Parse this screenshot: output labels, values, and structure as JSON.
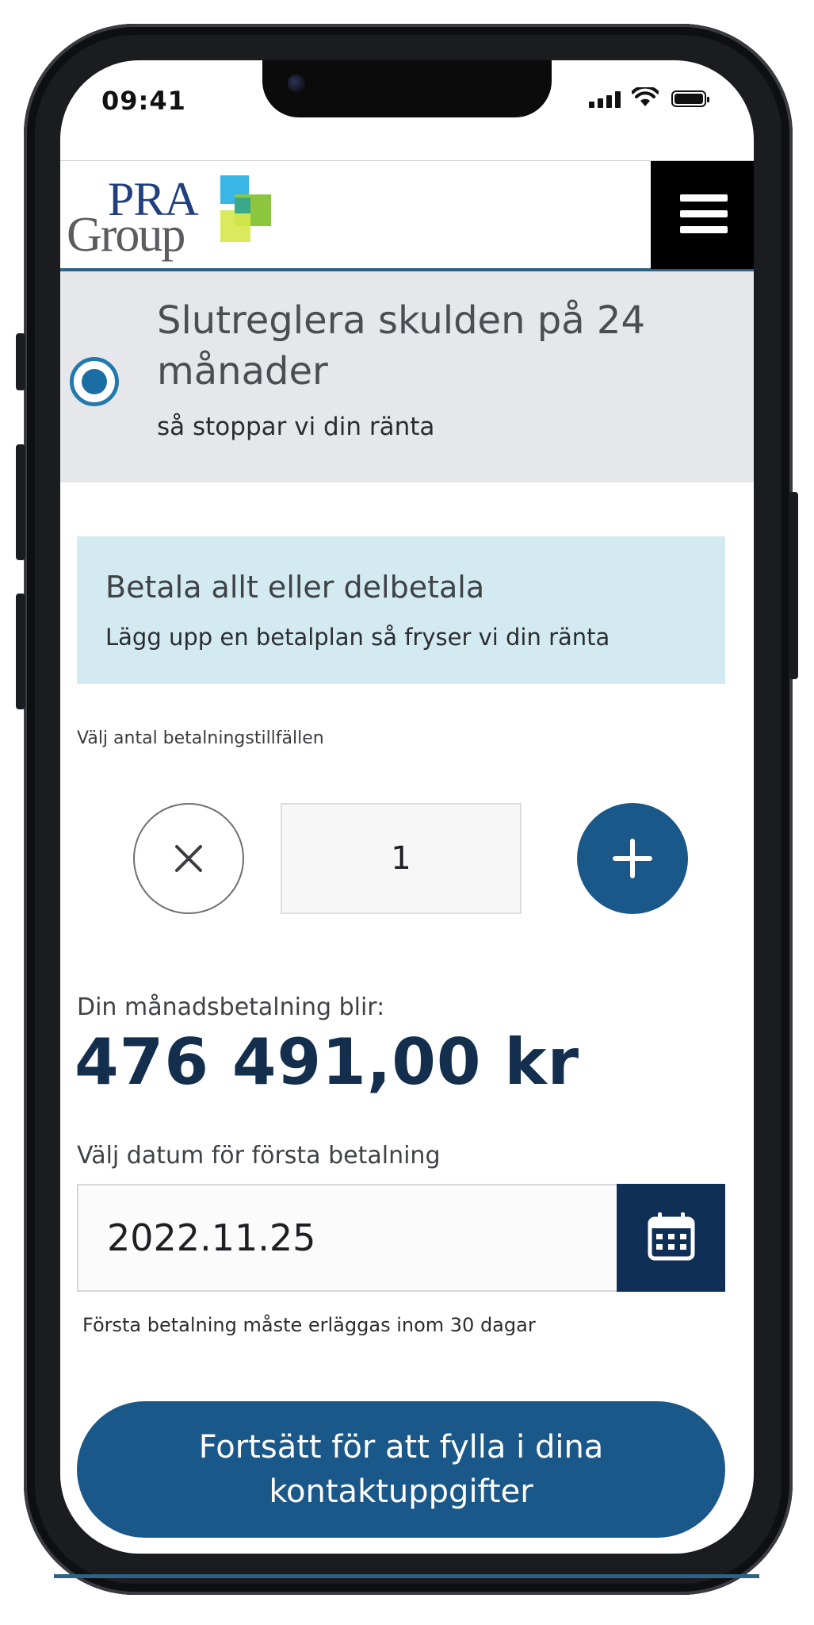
{
  "status_bar": {
    "time": "09:41"
  },
  "header": {
    "logo_text_top": "PRA",
    "logo_text_bottom": "Group",
    "menu_icon": "hamburger-menu-icon"
  },
  "option": {
    "title": "Slutreglera skulden på 24 månader",
    "subtitle": "så stoppar vi din ränta",
    "selected": true
  },
  "info_box": {
    "title": "Betala allt eller delbetala",
    "subtitle": "Lägg upp en betalplan så fryser vi din ränta"
  },
  "installments": {
    "label": "Välj antal betalningstillfällen",
    "value": "1",
    "decrement_icon": "close-icon",
    "increment_icon": "plus-icon"
  },
  "payment": {
    "label": "Din månadsbetalning blir:",
    "amount": "476 491,00 kr"
  },
  "first_payment": {
    "label": "Välj datum för första betalning",
    "date": "2022.11.25",
    "calendar_icon": "calendar-icon",
    "note": "Första betalning måste erläggas inom 30 dagar"
  },
  "cta": {
    "label": "Fortsätt för att fylla i dina kontaktuppgifter"
  },
  "colors": {
    "primary": "#1a5889",
    "dark_navy": "#0f2f56",
    "info_bg": "#d3ebf0",
    "option_bg": "#e5e7ea",
    "amount_text": "#132f4d"
  }
}
